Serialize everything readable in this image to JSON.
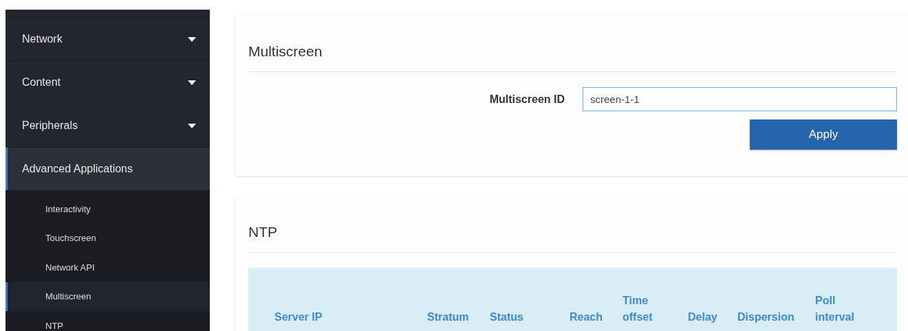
{
  "sidebar": {
    "items": [
      {
        "label": "Network",
        "caret": true,
        "selected": false
      },
      {
        "label": "Content",
        "caret": true,
        "selected": false
      },
      {
        "label": "Peripherals",
        "caret": true,
        "selected": false
      },
      {
        "label": "Advanced Applications",
        "caret": false,
        "selected": true,
        "children": [
          {
            "label": "Interactivity",
            "selected": false
          },
          {
            "label": "Touchscreen",
            "selected": false
          },
          {
            "label": "Network API",
            "selected": false
          },
          {
            "label": "Multiscreen",
            "selected": true
          },
          {
            "label": "NTP",
            "selected": false
          }
        ]
      }
    ]
  },
  "multiscreen_panel": {
    "title": "Multiscreen",
    "field_label": "Multiscreen ID",
    "field_value": "screen-1-1",
    "apply_button": "Apply"
  },
  "ntp_panel": {
    "title": "NTP",
    "table": {
      "columns": [
        "Server IP",
        "Stratum",
        "Status",
        "Reach",
        "Time offset",
        "Delay",
        "Dispersion",
        "Poll interval"
      ]
    }
  }
}
